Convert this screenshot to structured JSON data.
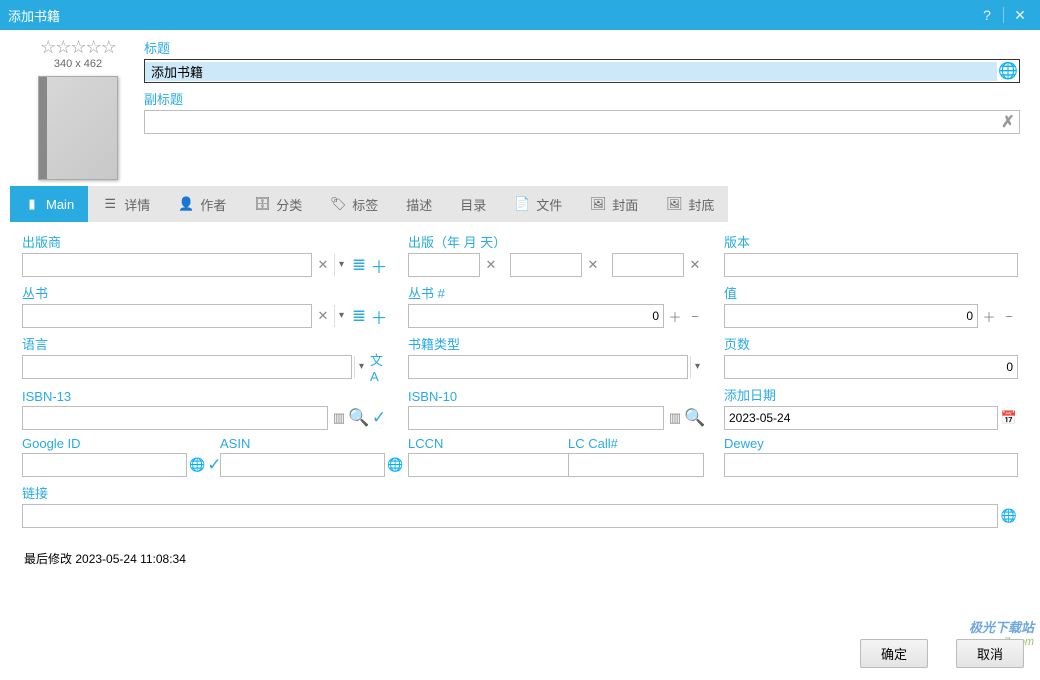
{
  "window": {
    "title": "添加书籍"
  },
  "header": {
    "dimensions": "340 x 462",
    "title_label": "标题",
    "title_value": "添加书籍",
    "subtitle_label": "副标题",
    "subtitle_value": ""
  },
  "tabs": {
    "main": "Main",
    "detail": "详情",
    "author": "作者",
    "category": "分类",
    "tags": "标签",
    "desc": "描述",
    "toc": "目录",
    "files": "文件",
    "cover": "封面",
    "back": "封底"
  },
  "labels": {
    "publisher": "出版商",
    "pubdate": "出版（年 月 天）",
    "edition": "版本",
    "series": "丛书",
    "seriesno": "丛书 #",
    "value": "值",
    "language": "语言",
    "booktype": "书籍类型",
    "pages": "页数",
    "isbn13": "ISBN-13",
    "isbn10": "ISBN-10",
    "adddate": "添加日期",
    "googleid": "Google ID",
    "asin": "ASIN",
    "lccn": "LCCN",
    "lccall": "LC Call#",
    "dewey": "Dewey",
    "link": "链接"
  },
  "values": {
    "publisher": "",
    "pub_y": "",
    "pub_m": "",
    "pub_d": "",
    "edition": "",
    "series": "",
    "seriesno": "0",
    "value": "0",
    "language": "",
    "booktype": "",
    "pages": "0",
    "isbn13": "",
    "isbn10": "",
    "adddate": "2023-05-24",
    "googleid": "",
    "asin": "",
    "lccn": "",
    "lccall": "",
    "dewey": "",
    "link": ""
  },
  "lastmod_label": "最后修改",
  "lastmod_value": "2023-05-24 11:08:34",
  "buttons": {
    "ok": "确定",
    "cancel": "取消"
  },
  "watermark": {
    "line1": "极光下载站",
    "line2": "www.xz7.com"
  }
}
